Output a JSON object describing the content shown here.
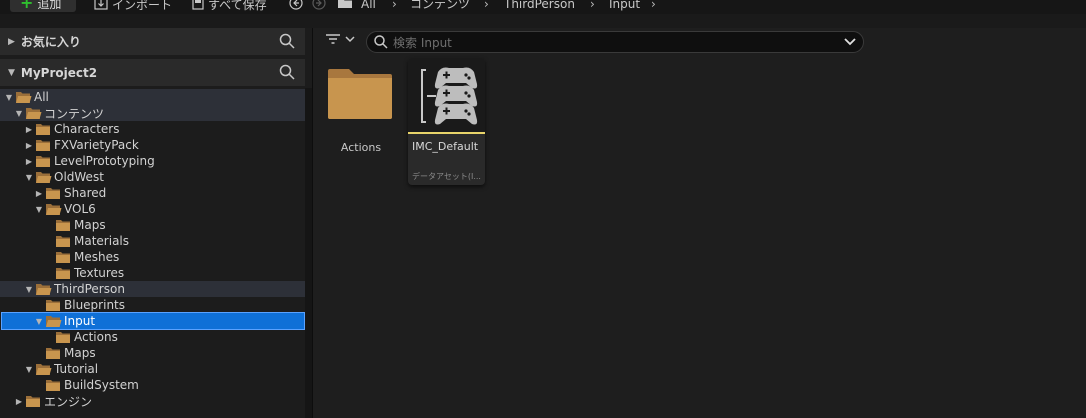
{
  "toolbar": {
    "add_label": "追加",
    "import_label": "インポート",
    "save_all_label": "すべて保存"
  },
  "breadcrumb": [
    "All",
    "コンテンツ",
    "ThirdPerson",
    "Input"
  ],
  "favorites": {
    "label": "お気に入り"
  },
  "project": {
    "label": "MyProject2"
  },
  "tree": [
    {
      "label": "All",
      "depth": 0,
      "expanded": true,
      "arrow": "down",
      "highlight": true
    },
    {
      "label": "コンテンツ",
      "depth": 1,
      "expanded": true,
      "arrow": "down",
      "highlight": true
    },
    {
      "label": "Characters",
      "depth": 2,
      "arrow": "right"
    },
    {
      "label": "FXVarietyPack",
      "depth": 2,
      "arrow": "right"
    },
    {
      "label": "LevelPrototyping",
      "depth": 2,
      "arrow": "right"
    },
    {
      "label": "OldWest",
      "depth": 2,
      "expanded": true,
      "arrow": "down"
    },
    {
      "label": "Shared",
      "depth": 3,
      "arrow": "right"
    },
    {
      "label": "VOL6",
      "depth": 3,
      "expanded": true,
      "arrow": "down"
    },
    {
      "label": "Maps",
      "depth": 4,
      "arrow": ""
    },
    {
      "label": "Materials",
      "depth": 4,
      "arrow": ""
    },
    {
      "label": "Meshes",
      "depth": 4,
      "arrow": ""
    },
    {
      "label": "Textures",
      "depth": 4,
      "arrow": ""
    },
    {
      "label": "ThirdPerson",
      "depth": 2,
      "expanded": true,
      "arrow": "down",
      "highlight": true
    },
    {
      "label": "Blueprints",
      "depth": 3,
      "arrow": ""
    },
    {
      "label": "Input",
      "depth": 3,
      "expanded": true,
      "arrow": "down",
      "selected": true
    },
    {
      "label": "Actions",
      "depth": 4,
      "arrow": ""
    },
    {
      "label": "Maps",
      "depth": 3,
      "arrow": ""
    },
    {
      "label": "Tutorial",
      "depth": 2,
      "expanded": true,
      "arrow": "down"
    },
    {
      "label": "BuildSystem",
      "depth": 3,
      "arrow": ""
    },
    {
      "label": "エンジン",
      "depth": 1,
      "arrow": "right"
    }
  ],
  "search": {
    "placeholder": "検索 Input"
  },
  "assets": {
    "folder": {
      "label": "Actions"
    },
    "item": {
      "label": "IMC_Default",
      "type": "データアセット(I..."
    }
  },
  "colors": {
    "folder": "#c8954e",
    "selection": "#0f70d7",
    "asset_bar": "#e8d46a",
    "add_plus": "#2fbf2f"
  }
}
